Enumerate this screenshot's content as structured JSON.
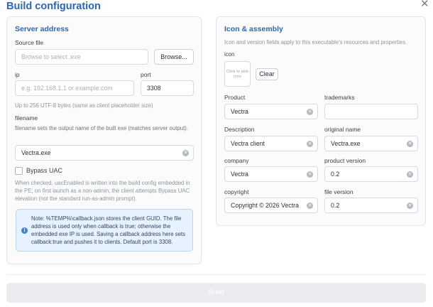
{
  "dialog": {
    "title": "Build configuration",
    "close": "✕"
  },
  "server": {
    "section_title": "Server address",
    "source_label": "Source file",
    "source_placeholder": "Browse to select .exe",
    "browse_label": "Browse...",
    "ip_label": "ip",
    "ip_placeholder": "e.g. 192.168.1.1 or example.com",
    "port_label": "port",
    "port_value": "3308",
    "ip_help": "Up to 256 UTF-8 bytes (same as client placeholder size)",
    "filename_label": "filename",
    "filename_help": "filename sets the output name of the built exe (matches server output).",
    "filename_value": "Vectra.exe",
    "bypass_label": "Bypass UAC",
    "bypass_checked": false,
    "bypass_help": "When checked, uacEnabled is written into the build config embedded in the PE; on first launch as a non-admin, the client attempts Bypass UAC elevation (not the standard run-as-admin prompt).",
    "note_icon": "i",
    "note_text": "Note: %TEMP%\\callback.json stores the client GUID. The file address is used only when callback is true; otherwise the embedded exe IP is used. Saving a callback address here sets callback:true and pushes it to clients. Default port is 3308."
  },
  "assembly": {
    "section_title": "Icon & assembly",
    "description": "Icon and version fields apply to this executable's resources and properties.",
    "icon_label": "icon",
    "icon_placeholder": "Click to pick icon",
    "clear_label": "Clear",
    "product_label": "Product",
    "product_value": "Vectra",
    "trademarks_label": "trademarks",
    "trademarks_value": "",
    "description_label": "Description",
    "description_value": "Vectra client",
    "original_name_label": "original name",
    "original_name_value": "Vectra.exe",
    "company_label": "company",
    "company_value": "Vectra",
    "product_version_label": "product version",
    "product_version_value": "0.2",
    "copyright_label": "copyright",
    "copyright_value": "Copyright © 2026 Vectra",
    "file_version_label": "file version",
    "file_version_value": "0.2"
  },
  "footer": {
    "build_label": "Build",
    "build_enabled": false
  },
  "colors": {
    "accent": "#2b67b7",
    "note_bg": "#e6f2fd",
    "note_icon": "#3a86d6",
    "disabled_button": "#e9ebee"
  }
}
